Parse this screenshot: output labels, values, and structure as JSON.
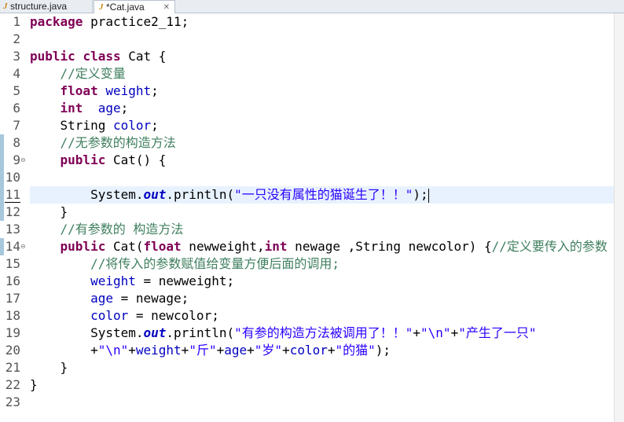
{
  "tabs": [
    {
      "label": "structure.java",
      "active": false
    },
    {
      "label": "*Cat.java",
      "active": true,
      "close_icon": "close-icon"
    }
  ],
  "editor": {
    "current_line": 11,
    "lines": [
      {
        "n": "1",
        "t": "package practice2_11;"
      },
      {
        "n": "2",
        "t": ""
      },
      {
        "n": "3",
        "t": "public class Cat {"
      },
      {
        "n": "4",
        "t": "    //定义变量"
      },
      {
        "n": "5",
        "t": "    float weight;"
      },
      {
        "n": "6",
        "t": "    int  age;"
      },
      {
        "n": "7",
        "t": "    String color;"
      },
      {
        "n": "8",
        "t": "    //无参数的构造方法"
      },
      {
        "n": "9",
        "t": "    public Cat() {"
      },
      {
        "n": "10",
        "t": ""
      },
      {
        "n": "11",
        "t": "        System.out.println(\"一只没有属性的猫诞生了！！\");"
      },
      {
        "n": "12",
        "t": "    }"
      },
      {
        "n": "13",
        "t": "    //有参数的 构造方法"
      },
      {
        "n": "14",
        "t": "    public Cat(float newweight,int newage ,String newcolor) {//定义要传入的参数"
      },
      {
        "n": "15",
        "t": "        //将传入的参数赋值给变量方便后面的调用;"
      },
      {
        "n": "16",
        "t": "        weight = newweight;"
      },
      {
        "n": "17",
        "t": "        age = newage;"
      },
      {
        "n": "18",
        "t": "        color = newcolor;"
      },
      {
        "n": "19",
        "t": "        System.out.println(\"有参的构造方法被调用了！！\"+\"\\n\"+\"产生了一只\""
      },
      {
        "n": "20",
        "t": "        +\"\\n\"+weight+\"斤\"+age+\"岁\"+color+\"的猫\");"
      },
      {
        "n": "21",
        "t": "    }"
      },
      {
        "n": "22",
        "t": "}"
      },
      {
        "n": "23",
        "t": ""
      }
    ]
  },
  "colors": {
    "keyword": "#7f0055",
    "field": "#0000c0",
    "string": "#2a00ff",
    "comment": "#3f7f5f",
    "current_line": "#e8f2fe",
    "change_bar": "#a7c8dc"
  }
}
